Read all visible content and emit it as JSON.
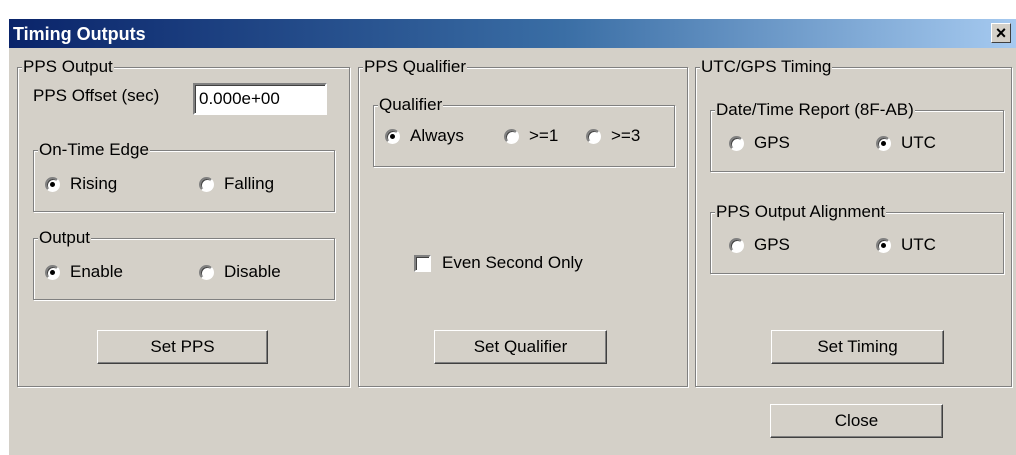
{
  "window": {
    "title": "Timing Outputs",
    "close_glyph": "×"
  },
  "pps_output": {
    "legend": "PPS Output",
    "offset_label": "PPS Offset (sec)",
    "offset_value": "0.000e+00",
    "edge": {
      "legend": "On-Time Edge",
      "rising": "Rising",
      "falling": "Falling",
      "selected": "Rising"
    },
    "output": {
      "legend": "Output",
      "enable": "Enable",
      "disable": "Disable",
      "selected": "Enable"
    },
    "set_button": "Set PPS"
  },
  "pps_qualifier": {
    "legend": "PPS Qualifier",
    "qualifier": {
      "legend": "Qualifier",
      "always": "Always",
      "ge1": ">=1",
      "ge3": ">=3",
      "selected": "Always"
    },
    "even_second_label": "Even Second Only",
    "even_second_checked": false,
    "set_button": "Set Qualifier"
  },
  "utc_gps_timing": {
    "legend": "UTC/GPS Timing",
    "report": {
      "legend": "Date/Time Report (8F-AB)",
      "gps": "GPS",
      "utc": "UTC",
      "selected": "UTC"
    },
    "alignment": {
      "legend": "PPS Output Alignment",
      "gps": "GPS",
      "utc": "UTC",
      "selected": "UTC"
    },
    "set_button": "Set Timing"
  },
  "close_button": "Close"
}
